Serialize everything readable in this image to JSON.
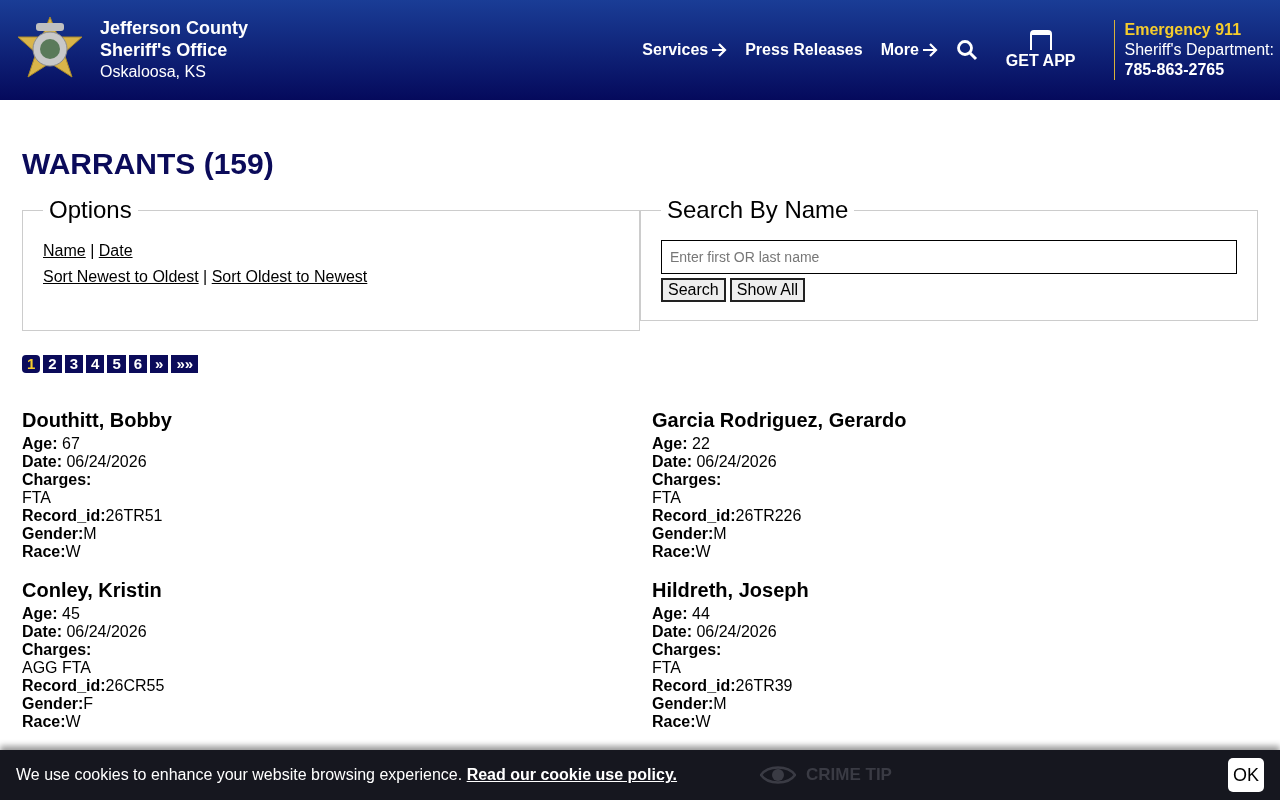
{
  "header": {
    "title_lines": [
      "Jefferson County",
      "Sheriff's Office"
    ],
    "location": "Oskaloosa, KS",
    "nav": [
      {
        "label": "Services",
        "arrow": true
      },
      {
        "label": "Press Releases",
        "arrow": false
      },
      {
        "label": "More",
        "arrow": true
      }
    ],
    "get_app": "GET APP",
    "emergency": "Emergency 911",
    "department": "Sheriff's Department:",
    "phone": "785-863-2765"
  },
  "page_title": "WARRANTS (159)",
  "options": {
    "legend": "Options",
    "sort_fields": [
      "Name",
      "|",
      "Date"
    ],
    "sort_orders": [
      "Sort Newest to Oldest",
      "|",
      "Sort Oldest to Newest"
    ]
  },
  "search": {
    "legend": "Search By Name",
    "placeholder": "Enter first OR last name",
    "buttons": [
      "Search",
      "Show All"
    ]
  },
  "pagination": [
    {
      "label": "1",
      "selected": true
    },
    {
      "label": "2",
      "selected": false
    },
    {
      "label": "3",
      "selected": false
    },
    {
      "label": "4",
      "selected": false
    },
    {
      "label": "5",
      "selected": false
    },
    {
      "label": "6",
      "selected": false
    },
    {
      "label": "»",
      "selected": false
    },
    {
      "label": "»»",
      "selected": false
    }
  ],
  "warrants": [
    {
      "name": "Douthitt, Bobby",
      "fields": [
        {
          "kind": "spaced",
          "label": "Age:",
          "value": "67"
        },
        {
          "kind": "spaced",
          "label": "Date:",
          "value": "06/24/2026"
        },
        {
          "kind": "block",
          "label": "Charges:",
          "value": "FTA"
        },
        {
          "kind": "tight",
          "label": "Record_id:",
          "value": "26TR51"
        },
        {
          "kind": "tight",
          "label": "Gender:",
          "value": "M"
        },
        {
          "kind": "tight",
          "label": "Race:",
          "value": "W"
        }
      ]
    },
    {
      "name": "Garcia Rodriguez, Gerardo",
      "fields": [
        {
          "kind": "spaced",
          "label": "Age:",
          "value": "22"
        },
        {
          "kind": "spaced",
          "label": "Date:",
          "value": "06/24/2026"
        },
        {
          "kind": "block",
          "label": "Charges:",
          "value": "FTA"
        },
        {
          "kind": "tight",
          "label": "Record_id:",
          "value": "26TR226"
        },
        {
          "kind": "tight",
          "label": "Gender:",
          "value": "M"
        },
        {
          "kind": "tight",
          "label": "Race:",
          "value": "W"
        }
      ]
    },
    {
      "name": "Conley, Kristin",
      "fields": [
        {
          "kind": "spaced",
          "label": "Age:",
          "value": "45"
        },
        {
          "kind": "spaced",
          "label": "Date:",
          "value": "06/24/2026"
        },
        {
          "kind": "block",
          "label": "Charges:",
          "value": "AGG FTA"
        },
        {
          "kind": "tight",
          "label": "Record_id:",
          "value": "26CR55"
        },
        {
          "kind": "tight",
          "label": "Gender:",
          "value": "F"
        },
        {
          "kind": "tight",
          "label": "Race:",
          "value": "W"
        }
      ]
    },
    {
      "name": "Hildreth, Joseph",
      "fields": [
        {
          "kind": "spaced",
          "label": "Age:",
          "value": "44"
        },
        {
          "kind": "spaced",
          "label": "Date:",
          "value": "06/24/2026"
        },
        {
          "kind": "block",
          "label": "Charges:",
          "value": "FTA"
        },
        {
          "kind": "tight",
          "label": "Record_id:",
          "value": "26TR39"
        },
        {
          "kind": "tight",
          "label": "Gender:",
          "value": "M"
        },
        {
          "kind": "tight",
          "label": "Race:",
          "value": "W"
        }
      ]
    }
  ],
  "bottom_nav": [
    {
      "label": "CRIME TIP"
    }
  ],
  "cookie": {
    "text": "We use cookies to enhance your website browsing experience.",
    "link": "Read our cookie use policy.",
    "button": "OK"
  }
}
